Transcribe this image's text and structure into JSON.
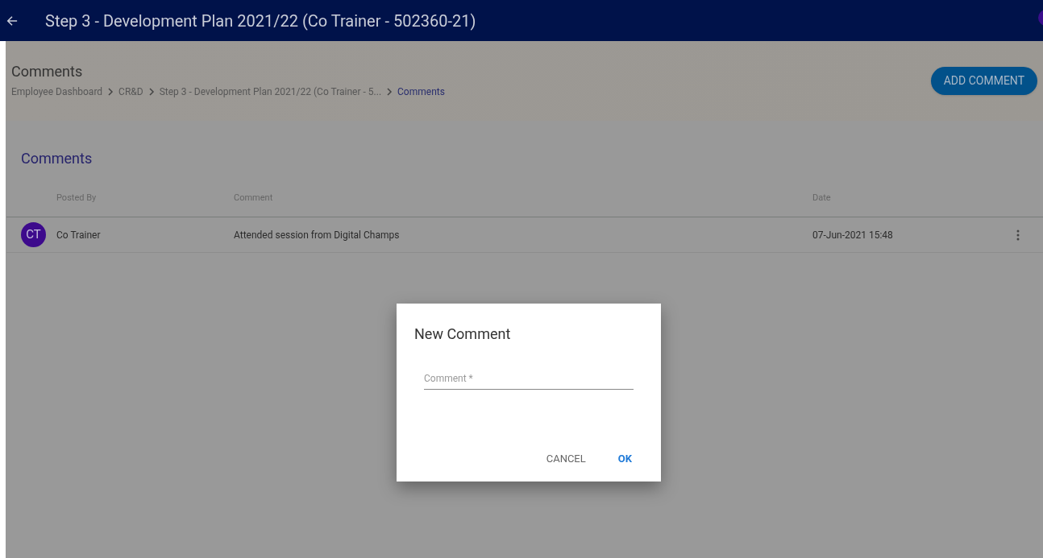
{
  "top_bar": {
    "title": "Step 3 - Development Plan 2021/22 (Co Trainer - 502360-21)"
  },
  "header": {
    "title": "Comments",
    "breadcrumbs": [
      {
        "label": "Employee Dashboard",
        "selected": false
      },
      {
        "label": "CR&D",
        "selected": false
      },
      {
        "label": "Step 3 - Development Plan 2021/22 (Co Trainer - 5...",
        "selected": false
      },
      {
        "label": "Comments",
        "selected": true
      }
    ],
    "add_button": "ADD COMMENT"
  },
  "section_title": "Comments",
  "table": {
    "columns": [
      "Posted By",
      "Comment",
      "Date"
    ],
    "rows": [
      {
        "initials": "CT",
        "posted_by": "Co Trainer",
        "comment": "Attended session from Digital Champs",
        "date": "07-Jun-2021 15:48"
      }
    ]
  },
  "dialog": {
    "title": "New Comment",
    "field": {
      "placeholder": "Comment *"
    },
    "buttons": [
      {
        "label": "CANCEL",
        "kind": "secondary"
      },
      {
        "label": "OK",
        "kind": "primary"
      }
    ]
  }
}
